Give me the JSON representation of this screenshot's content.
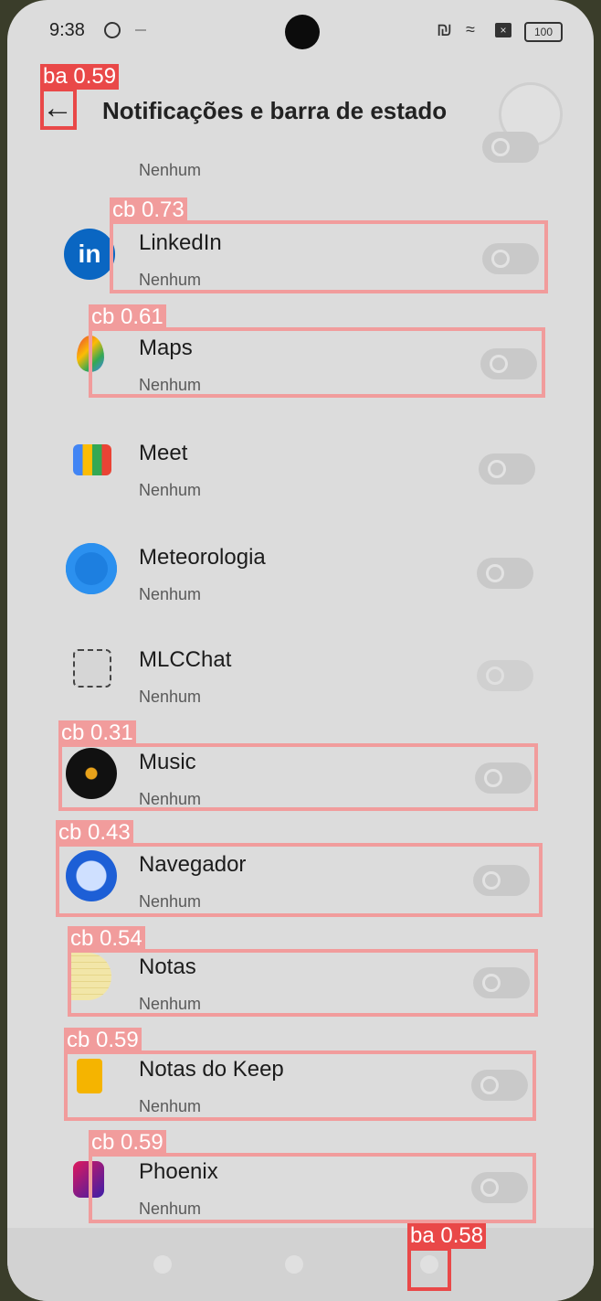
{
  "status": {
    "time": "9:38",
    "battery": "100"
  },
  "header": {
    "title": "Notificações e barra de estado",
    "back_label": "←"
  },
  "apps": [
    {
      "name": "",
      "sub": "Nenhum"
    },
    {
      "name": "LinkedIn",
      "sub": "Nenhum"
    },
    {
      "name": "Maps",
      "sub": "Nenhum"
    },
    {
      "name": "Meet",
      "sub": "Nenhum"
    },
    {
      "name": "Meteorologia",
      "sub": "Nenhum"
    },
    {
      "name": "MLCChat",
      "sub": "Nenhum"
    },
    {
      "name": "Music",
      "sub": "Nenhum"
    },
    {
      "name": "Navegador",
      "sub": "Nenhum"
    },
    {
      "name": "Notas",
      "sub": "Nenhum"
    },
    {
      "name": "Notas do Keep",
      "sub": "Nenhum"
    },
    {
      "name": "Phoenix",
      "sub": "Nenhum"
    }
  ],
  "detections": [
    {
      "label": "ba 0.59"
    },
    {
      "label": "cb 0.73"
    },
    {
      "label": "cb 0.61"
    },
    {
      "label": "cb 0.31"
    },
    {
      "label": "cb 0.43"
    },
    {
      "label": "cb 0.54"
    },
    {
      "label": "cb 0.59"
    },
    {
      "label": "cb 0.59"
    },
    {
      "label": "ba 0.58"
    }
  ],
  "colors": {
    "accent": "#e94848",
    "overlay": "#f19c9c"
  },
  "icons": [
    "settings-icon",
    "nfc-icon",
    "wifi-icon",
    "sim-icon",
    "battery-icon",
    "back-arrow-icon"
  ]
}
